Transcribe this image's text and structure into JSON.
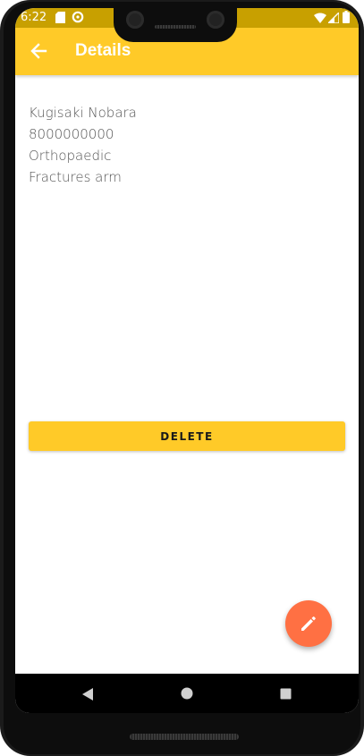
{
  "status_bar": {
    "time": "6:22",
    "icons": [
      "sd-card-icon",
      "data-saver-icon",
      "wifi-icon",
      "signal-icon",
      "battery-icon"
    ]
  },
  "app_bar": {
    "title": "Details",
    "back_icon": "arrow-back-icon",
    "color": "#ffca28"
  },
  "details": {
    "name": "Kugisaki Nobara",
    "phone": "8000000000",
    "department": "Orthopaedic",
    "condition": "Fractures arm"
  },
  "actions": {
    "delete_label": "DELETE",
    "edit_icon": "pencil-icon",
    "fab_color": "#ff7043"
  },
  "nav_bar": {
    "buttons": [
      "back-triangle-icon",
      "home-circle-icon",
      "recents-square-icon"
    ]
  }
}
